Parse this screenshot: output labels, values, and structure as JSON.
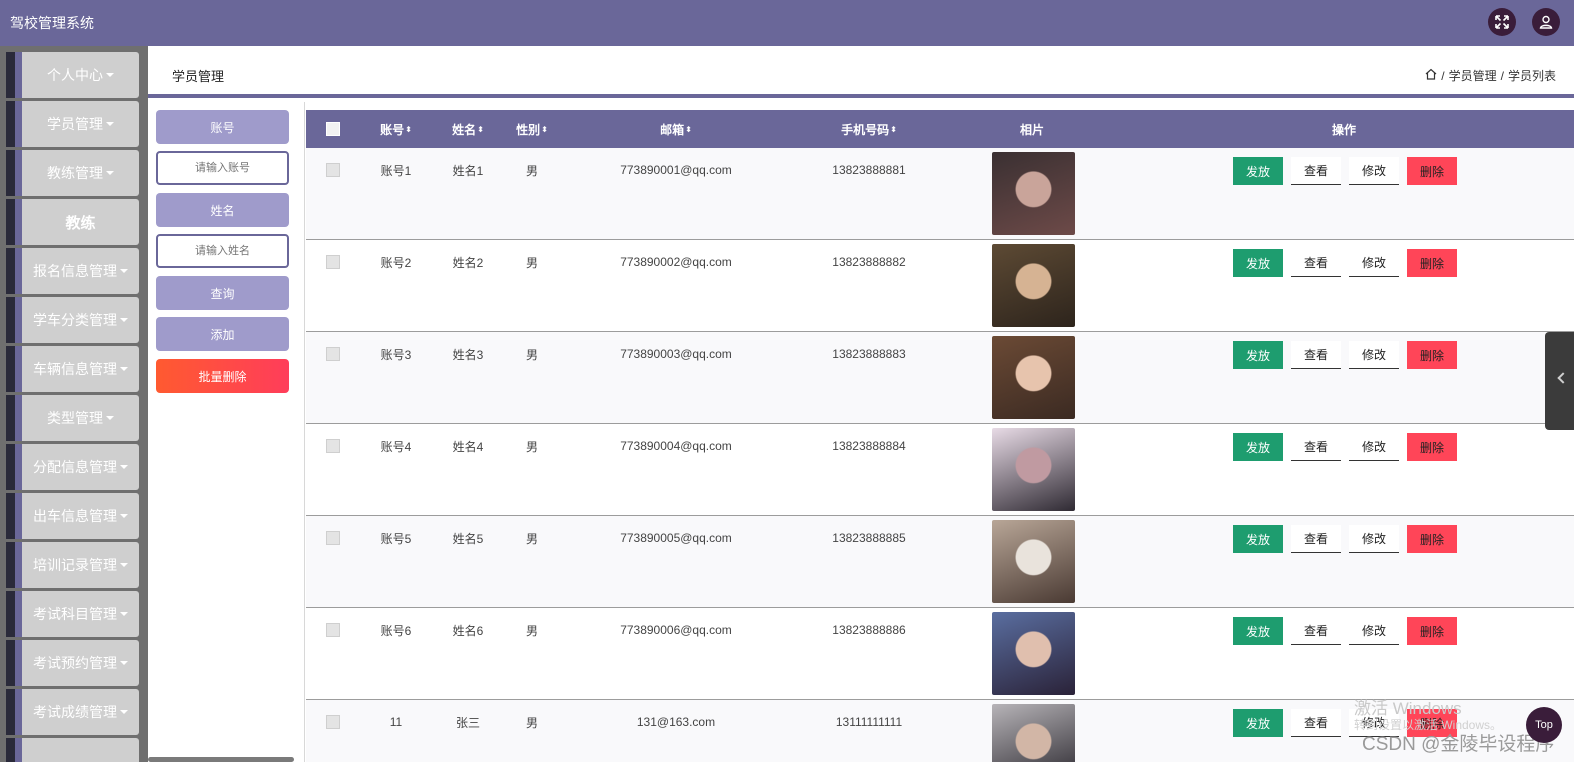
{
  "app": {
    "title": "驾校管理系统",
    "fullscreen_icon": "expand-arrows-icon",
    "user_icon": "user-icon"
  },
  "sidebar": {
    "items": [
      {
        "label": "个人中心",
        "caret": true,
        "sub": false
      },
      {
        "label": "学员管理",
        "caret": true,
        "sub": false
      },
      {
        "label": "教练管理",
        "caret": true,
        "sub": false
      },
      {
        "label": "教练",
        "caret": false,
        "sub": true
      },
      {
        "label": "报名信息管理",
        "caret": true,
        "sub": false
      },
      {
        "label": "学车分类管理",
        "caret": true,
        "sub": false
      },
      {
        "label": "车辆信息管理",
        "caret": true,
        "sub": false
      },
      {
        "label": "类型管理",
        "caret": true,
        "sub": false
      },
      {
        "label": "分配信息管理",
        "caret": true,
        "sub": false
      },
      {
        "label": "出车信息管理",
        "caret": true,
        "sub": false
      },
      {
        "label": "培训记录管理",
        "caret": true,
        "sub": false
      },
      {
        "label": "考试科目管理",
        "caret": true,
        "sub": false
      },
      {
        "label": "考试预约管理",
        "caret": true,
        "sub": false
      },
      {
        "label": "考试成绩管理",
        "caret": true,
        "sub": false
      },
      {
        "label": "",
        "caret": false,
        "sub": false
      }
    ]
  },
  "header": {
    "page_title": "学员管理",
    "breadcrumb": [
      "学员管理",
      "学员列表"
    ],
    "breadcrumb_sep": "/"
  },
  "search": {
    "account_label": "账号",
    "account_placeholder": "请输入账号",
    "name_label": "姓名",
    "name_placeholder": "请输入姓名",
    "query_button": "查询",
    "add_button": "添加",
    "batch_delete_button": "批量删除"
  },
  "table": {
    "columns": {
      "account": "账号",
      "name": "姓名",
      "gender": "性别",
      "email": "邮箱",
      "phone": "手机号码",
      "photo": "相片",
      "actions": "操作"
    },
    "sort_glyph": "⬍",
    "action_labels": {
      "issue": "发放",
      "view": "查看",
      "edit": "修改",
      "delete": "删除"
    },
    "rows": [
      {
        "account": "账号1",
        "name": "姓名1",
        "gender": "男",
        "email": "773890001@qq.com",
        "phone": "13823888881",
        "photo_colors": [
          "#3a3032",
          "#c9a49a",
          "#6d4a48"
        ]
      },
      {
        "account": "账号2",
        "name": "姓名2",
        "gender": "男",
        "email": "773890002@qq.com",
        "phone": "13823888882",
        "photo_colors": [
          "#5d4a34",
          "#d6b393",
          "#2d241c"
        ]
      },
      {
        "account": "账号3",
        "name": "姓名3",
        "gender": "男",
        "email": "773890003@qq.com",
        "phone": "13823888883",
        "photo_colors": [
          "#6b4a35",
          "#e7c4ad",
          "#3b2a22"
        ]
      },
      {
        "account": "账号4",
        "name": "姓名4",
        "gender": "男",
        "email": "773890004@qq.com",
        "phone": "13823888884",
        "photo_colors": [
          "#e8dbe6",
          "#c09aa1",
          "#2f2a33"
        ]
      },
      {
        "account": "账号5",
        "name": "姓名5",
        "gender": "男",
        "email": "773890005@qq.com",
        "phone": "13823888885",
        "photo_colors": [
          "#b8a697",
          "#e9e3dc",
          "#4a3a33"
        ]
      },
      {
        "account": "账号6",
        "name": "姓名6",
        "gender": "男",
        "email": "773890006@qq.com",
        "phone": "13823888886",
        "photo_colors": [
          "#5a6ea0",
          "#e0bfae",
          "#2a2238"
        ]
      },
      {
        "account": "11",
        "name": "张三",
        "gender": "男",
        "email": "131@163.com",
        "phone": "13111111111",
        "photo_colors": [
          "#b7b4b8",
          "#d2b6a6",
          "#26232a"
        ]
      }
    ]
  },
  "overlay": {
    "watermark_line1": "激活 Windows",
    "watermark_line2": "转到设置以激活 Windows。",
    "watermark_csdn": "CSDN @金陵毕设程序",
    "top_button": "Top"
  }
}
